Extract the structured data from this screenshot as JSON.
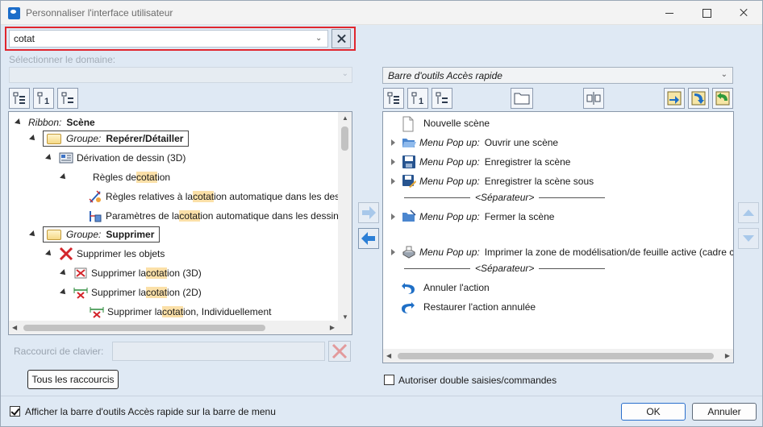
{
  "window": {
    "title": "Personnaliser l'interface utilisateur"
  },
  "search": {
    "value": "cotat"
  },
  "domain": {
    "label": "Sélectionner le domaine:",
    "value": ""
  },
  "tree": {
    "ribbon_prefix": "Ribbon:",
    "ribbon_name": "Scène",
    "group_prefix": "Groupe:",
    "group1_name": "Repérer/Détailler",
    "item_derivation": "Dérivation de dessin (3D)",
    "item_regles_pre": "Règles de ",
    "item_regles_mark": "cotat",
    "item_regles_post": "ion",
    "item_regles_rel_pre": "Règles relatives à la ",
    "item_regles_rel_mark": "cotat",
    "item_regles_rel_post": "ion automatique dans les des",
    "item_params_pre": "Paramètres de la ",
    "item_params_mark": "cotat",
    "item_params_post": "ion automatique dans les dessin",
    "group2_name": "Supprimer",
    "item_suppr_objets": "Supprimer les objets",
    "item_suppr3d_pre": "Supprimer la ",
    "item_suppr3d_mark": "cotat",
    "item_suppr3d_post": "ion (3D)",
    "item_suppr2d_pre": "Supprimer la ",
    "item_suppr2d_mark": "cotat",
    "item_suppr2d_post": "ion (2D)",
    "item_supprind_pre": "Supprimer la ",
    "item_supprind_mark": "cotat",
    "item_supprind_post": "ion, Individuellement"
  },
  "right": {
    "toolbar_select": "Barre d'outils Accès rapide",
    "popup_prefix": "Menu Pop up:",
    "separator": "<Séparateur>",
    "items": {
      "nouvelle": "Nouvelle scène",
      "ouvrir": "Ouvrir une scène",
      "enregistrer": "Enregistrer la scène",
      "enregistrer_sous": "Enregistrer la scène sous",
      "fermer": "Fermer la scène",
      "imprimer": "Imprimer la zone de modélisation/de feuille active (cadre c",
      "annuler": "Annuler l'action",
      "restaurer": "Restaurer l'action annulée"
    }
  },
  "shortcut": {
    "label": "Raccourci de clavier:",
    "value": ""
  },
  "buttons": {
    "all_shortcuts": "Tous les raccourcis",
    "ok": "OK",
    "cancel": "Annuler"
  },
  "options": {
    "allow_double": "Autoriser double saisies/commandes",
    "allow_double_checked": false,
    "show_toolbar": "Afficher la barre d'outils Accès rapide sur la barre de menu",
    "show_toolbar_checked": true
  }
}
